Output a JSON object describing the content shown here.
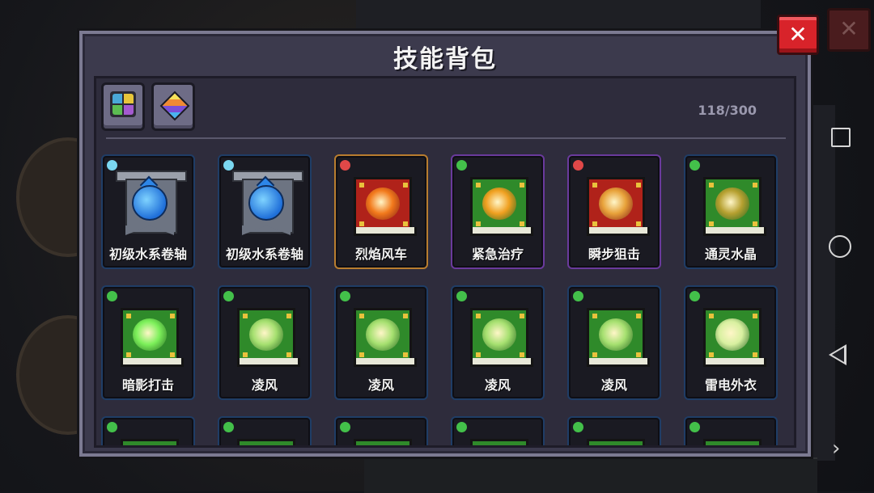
{
  "background": {
    "close_glyph": "✕"
  },
  "panel": {
    "title": "技能背包",
    "capacity": "118/300",
    "close_glyph": "✕",
    "filters": [
      {
        "name": "category-filter",
        "icon": "grid-icon"
      },
      {
        "name": "rarity-filter",
        "icon": "gem-icon"
      }
    ]
  },
  "skills": [
    {
      "label": "初级水系卷轴",
      "frame": "blue",
      "badge": "#7ad7f0",
      "art": "water-scroll"
    },
    {
      "label": "初级水系卷轴",
      "frame": "blue",
      "badge": "#7ad7f0",
      "art": "water-scroll"
    },
    {
      "label": "烈焰风车",
      "frame": "orange",
      "badge": "#e04848",
      "art": "red-book",
      "core": "#f27a1c"
    },
    {
      "label": "紧急治疗",
      "frame": "purple",
      "badge": "#43c04a",
      "art": "green-book",
      "core": "#f0a020"
    },
    {
      "label": "瞬步狙击",
      "frame": "purple",
      "badge": "#e04848",
      "art": "red-book",
      "core": "#e8a23a"
    },
    {
      "label": "通灵水晶",
      "frame": "blue",
      "badge": "#43c04a",
      "art": "green-book",
      "core": "#b6a030"
    },
    {
      "label": "暗影打击",
      "frame": "blue",
      "badge": "#43c04a",
      "art": "green-book",
      "core": "#7cf05a"
    },
    {
      "label": "凌风",
      "frame": "blue",
      "badge": "#43c04a",
      "art": "green-book",
      "core": "#a6e070"
    },
    {
      "label": "凌风",
      "frame": "blue",
      "badge": "#43c04a",
      "art": "green-book",
      "core": "#a6e070"
    },
    {
      "label": "凌风",
      "frame": "blue",
      "badge": "#43c04a",
      "art": "green-book",
      "core": "#a6e070"
    },
    {
      "label": "凌风",
      "frame": "blue",
      "badge": "#43c04a",
      "art": "green-book",
      "core": "#a6e070"
    },
    {
      "label": "雷电外衣",
      "frame": "blue",
      "badge": "#43c04a",
      "art": "green-book",
      "core": "#d8f0a0"
    }
  ],
  "nav": {
    "chevron": "›"
  }
}
